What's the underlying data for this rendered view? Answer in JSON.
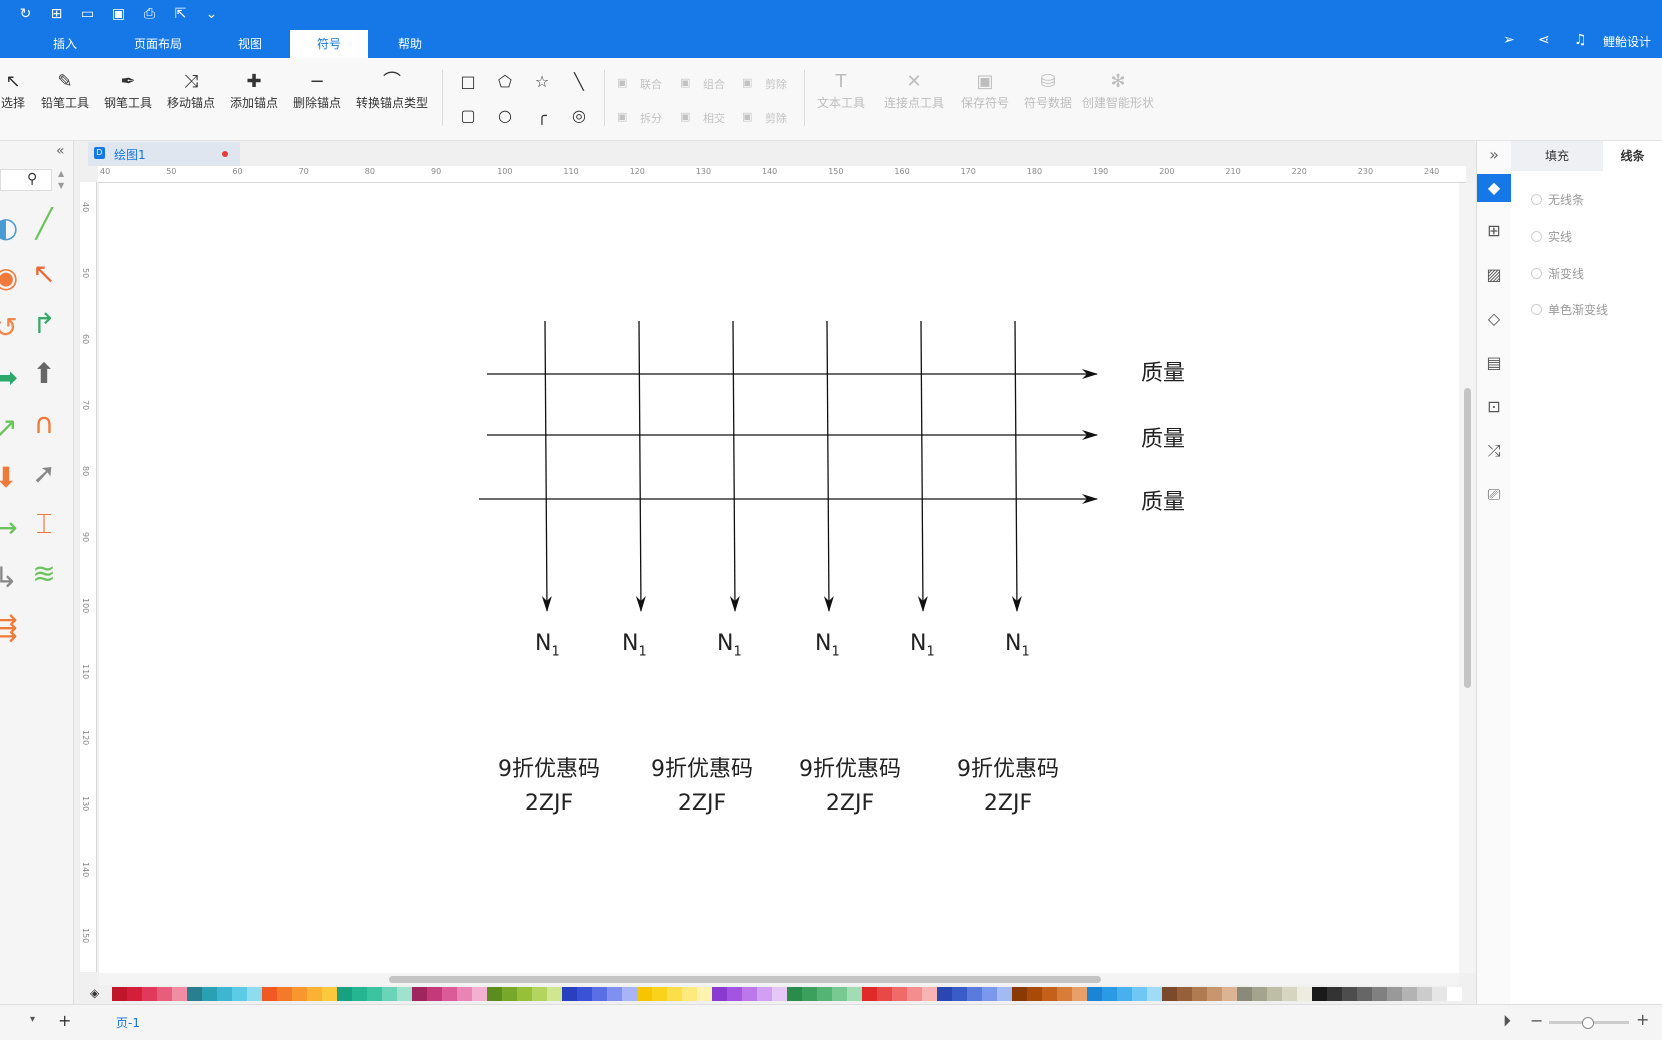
{
  "colors": {
    "accent": "#1677e6",
    "canvas": "#ffffff",
    "panel": "#f5f5f5"
  },
  "quick_access": [
    {
      "name": "redo-icon",
      "glyph": "↻"
    },
    {
      "name": "new-file-icon",
      "glyph": "⊞"
    },
    {
      "name": "open-folder-icon",
      "glyph": "▭"
    },
    {
      "name": "save-icon",
      "glyph": "▣"
    },
    {
      "name": "print-icon",
      "glyph": "⎙"
    },
    {
      "name": "export-icon",
      "glyph": "⇱"
    },
    {
      "name": "customize-icon",
      "glyph": "⌄"
    }
  ],
  "menu_tabs": [
    {
      "label": "插入"
    },
    {
      "label": "页面布局"
    },
    {
      "label": "视图"
    },
    {
      "label": "符号",
      "active": true
    },
    {
      "label": "帮助"
    }
  ],
  "user": {
    "name": "鲤鲐设计"
  },
  "ribbon": {
    "tools": [
      {
        "label": "选择",
        "icon": "select-icon",
        "glyph": "↖"
      },
      {
        "label": "铅笔工具",
        "icon": "pencil-icon",
        "glyph": "✎"
      },
      {
        "label": "钢笔工具",
        "icon": "pen-icon",
        "glyph": "✒"
      },
      {
        "label": "移动锚点",
        "icon": "move-anchor-icon",
        "glyph": "⤨"
      },
      {
        "label": "添加锚点",
        "icon": "add-anchor-icon",
        "glyph": "✚"
      },
      {
        "label": "删除锚点",
        "icon": "delete-anchor-icon",
        "glyph": "−"
      },
      {
        "label": "转换锚点类型",
        "icon": "convert-anchor-icon",
        "glyph": "⌒"
      }
    ],
    "shapes": [
      {
        "name": "rectangle-icon",
        "glyph": "□"
      },
      {
        "name": "pentagon-icon",
        "glyph": "⬠"
      },
      {
        "name": "star-icon",
        "glyph": "☆"
      },
      {
        "name": "line-icon",
        "glyph": "╲"
      },
      {
        "name": "rounded-rect-icon",
        "glyph": "▢"
      },
      {
        "name": "circle-icon",
        "glyph": "○"
      },
      {
        "name": "arc-icon",
        "glyph": "╭"
      },
      {
        "name": "spiral-icon",
        "glyph": "◎"
      }
    ],
    "boolean_ops": [
      {
        "label": "联合",
        "name": "union-button"
      },
      {
        "label": "组合",
        "name": "combine-button"
      },
      {
        "label": "剪除",
        "name": "subtract-button"
      },
      {
        "label": "拆分",
        "name": "split-button"
      },
      {
        "label": "相交",
        "name": "intersect-button"
      },
      {
        "label": "剪除",
        "name": "subtract-button-2"
      }
    ],
    "actions": [
      {
        "label": "文本工具",
        "icon": "text-tool-icon",
        "glyph": "T"
      },
      {
        "label": "连接点工具",
        "icon": "connection-point-icon",
        "glyph": "✕"
      },
      {
        "label": "保存符号",
        "icon": "save-symbol-icon",
        "glyph": "▣"
      },
      {
        "label": "符号数据",
        "icon": "symbol-data-icon",
        "glyph": "⛁"
      },
      {
        "label": "创建智能形状",
        "icon": "smart-shape-icon",
        "glyph": "✻"
      }
    ]
  },
  "document": {
    "tab_title": "绘图1"
  },
  "ruler": {
    "h_ticks": [
      "40",
      "50",
      "60",
      "70",
      "80",
      "90",
      "100",
      "110",
      "120",
      "130",
      "140",
      "150",
      "160",
      "170",
      "180",
      "190",
      "200",
      "210",
      "220",
      "230",
      "240"
    ],
    "v_ticks": [
      "40",
      "50",
      "60",
      "70",
      "80",
      "90",
      "100",
      "110",
      "120",
      "130",
      "140",
      "150"
    ]
  },
  "canvas": {
    "row_labels": [
      "质量",
      "质量",
      "质量"
    ],
    "column_labels": [
      {
        "main": "N",
        "sub": "1"
      },
      {
        "main": "N",
        "sub": "1"
      },
      {
        "main": "N",
        "sub": "1"
      },
      {
        "main": "N",
        "sub": "1"
      },
      {
        "main": "N",
        "sub": "1"
      },
      {
        "main": "N",
        "sub": "1"
      }
    ],
    "promos": [
      {
        "line1": "9折优惠码",
        "line2": "2ZJF"
      },
      {
        "line1": "9折优惠码",
        "line2": "2ZJF"
      },
      {
        "line1": "9折优惠码",
        "line2": "2ZJF"
      },
      {
        "line1": "9折优惠码",
        "line2": "2ZJF"
      }
    ]
  },
  "right_panel": {
    "tabs": [
      {
        "label": "填充"
      },
      {
        "label": "线条",
        "active": true
      }
    ],
    "line_options": [
      "无线条",
      "实线",
      "渐变线",
      "单色渐变线"
    ]
  },
  "status": {
    "page_label": "页-1"
  },
  "palette": [
    "#c0152a",
    "#d41f3a",
    "#e0395b",
    "#e85c7c",
    "#f08ca3",
    "#2a7f8e",
    "#2aa0b5",
    "#3fb6d1",
    "#5ccbe6",
    "#8fdcf0",
    "#f05a22",
    "#f47a2a",
    "#f8962f",
    "#fbb134",
    "#fcc93d",
    "#18a080",
    "#25b590",
    "#3cc4a0",
    "#6ad3b8",
    "#9fe3cf",
    "#a0245e",
    "#c23a7a",
    "#dc5a97",
    "#ea84b4",
    "#f4b0d0",
    "#5a8c1e",
    "#78a82a",
    "#96c03a",
    "#b4d460",
    "#d0e690",
    "#2a3fc0",
    "#3a52d6",
    "#5a6ee6",
    "#8090f0",
    "#a8b4f6",
    "#f7c500",
    "#f9d21c",
    "#fbde4a",
    "#fde97c",
    "#fef3b0",
    "#8a3ad0",
    "#a354e0",
    "#bc78ea",
    "#d2a0f2",
    "#e6c8f8",
    "#2a8c4a",
    "#3aa05c",
    "#54b474",
    "#78c892",
    "#a0dcb4",
    "#e02a2a",
    "#e84848",
    "#f06a6a",
    "#f48e8e",
    "#f8b4b4",
    "#2a46b0",
    "#3a5cc8",
    "#5a7ade",
    "#7c98ea",
    "#a4baf2",
    "#8a3a00",
    "#a84a08",
    "#c4601a",
    "#d87c3a",
    "#e8a06a",
    "#1c84d4",
    "#2a9ae4",
    "#48b0ee",
    "#70c6f4",
    "#a0dcf8",
    "#7a4a2a",
    "#96603a",
    "#b07a52",
    "#c8966e",
    "#dcb494",
    "#8a8a7a",
    "#a4a48e",
    "#bebea6",
    "#d6d6c0",
    "#ecece0",
    "#1a1a1a",
    "#333333",
    "#4d4d4d",
    "#666666",
    "#808080",
    "#999999",
    "#b3b3b3",
    "#cccccc",
    "#e6e6e6",
    "#ffffff"
  ],
  "left_library": [
    {
      "glyph": "◐",
      "color": "#4a9ad4"
    },
    {
      "glyph": "╱",
      "color": "#6ac45a"
    },
    {
      "glyph": "◉",
      "color": "#f07a3a"
    },
    {
      "glyph": "↖",
      "color": "#e86a3a"
    },
    {
      "glyph": "↺",
      "color": "#f0874a"
    },
    {
      "glyph": "↱",
      "color": "#3aaa6a"
    },
    {
      "glyph": "➡",
      "color": "#2aaa6a"
    },
    {
      "glyph": "⬆",
      "color": "#666666"
    },
    {
      "glyph": "↗",
      "color": "#6ac45a"
    },
    {
      "glyph": "∩",
      "color": "#f07a3a"
    },
    {
      "glyph": "⬇",
      "color": "#f07a3a"
    },
    {
      "glyph": "➚",
      "color": "#888888"
    },
    {
      "glyph": "↪",
      "color": "#6ac45a"
    },
    {
      "glyph": "⌶",
      "color": "#f07a3a"
    },
    {
      "glyph": "↳",
      "color": "#888888"
    },
    {
      "glyph": "≋",
      "color": "#6ac45a"
    },
    {
      "glyph": "⇶",
      "color": "#f07a3a"
    }
  ]
}
